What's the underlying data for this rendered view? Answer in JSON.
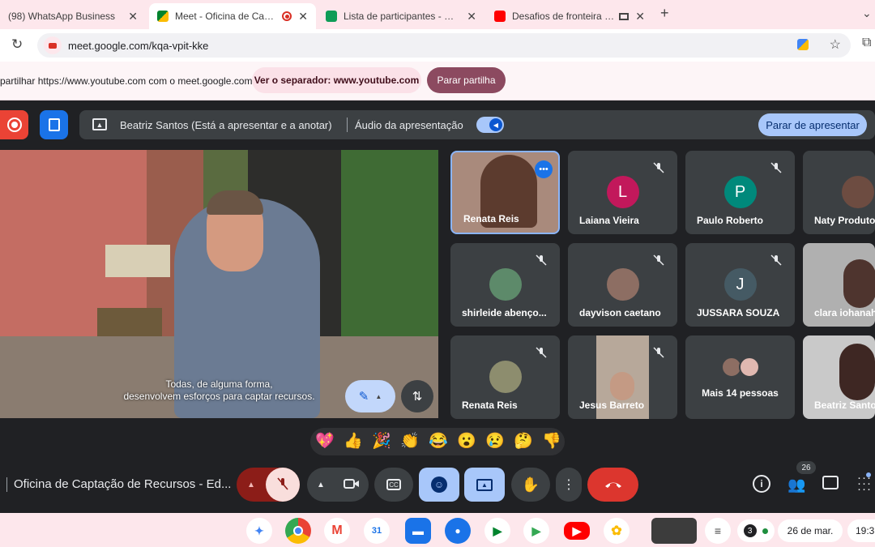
{
  "browser": {
    "tabs": [
      {
        "title": "(98) WhatsApp Business"
      },
      {
        "title": "Meet - Oficina de Captação"
      },
      {
        "title": "Lista de participantes - Oficina"
      },
      {
        "title": "Desafios de fronteira no de"
      }
    ],
    "new_tab": "+",
    "url": "meet.google.com/kqa-vpit-kke"
  },
  "sharebar": {
    "message": "partilhar https://www.youtube.com com o meet.google.com...",
    "view_tab_label": "Ver o separador: www.youtube.com",
    "stop_share_label": "Parar partilha"
  },
  "presenter": {
    "status": "Beatriz Santos (Está a apresentar e a anotar)",
    "audio_label": "Áudio da apresentação",
    "stop_presenting_label": "Parar de apresentar"
  },
  "video": {
    "caption_line1": "Todas, de alguma forma,",
    "caption_line2": "desenvolvem esforços para captar recursos."
  },
  "participants": [
    {
      "name": "Renata Reis",
      "initial": "",
      "color": "#7a5a4a",
      "muted": false,
      "camera": true
    },
    {
      "name": "Laiana Vieira",
      "initial": "L",
      "color": "#c2185b",
      "muted": true,
      "camera": false
    },
    {
      "name": "Paulo Roberto",
      "initial": "P",
      "color": "#00897b",
      "muted": true,
      "camera": false
    },
    {
      "name": "Naty Produto",
      "initial": "",
      "color": "#6d4c41",
      "muted": false,
      "camera": false
    },
    {
      "name": "shirleide abenço...",
      "initial": "",
      "color": "#5d8a6a",
      "muted": true,
      "camera": false
    },
    {
      "name": "dayvison caetano",
      "initial": "",
      "color": "#8d6e63",
      "muted": true,
      "camera": false
    },
    {
      "name": "JUSSARA SOUZA",
      "initial": "J",
      "color": "#455a64",
      "muted": true,
      "camera": false
    },
    {
      "name": "clara iohanah",
      "initial": "",
      "color": "#9e9e9e",
      "muted": false,
      "camera": true
    },
    {
      "name": "Renata Reis",
      "initial": "",
      "color": "#8d8d6e",
      "muted": true,
      "camera": false
    },
    {
      "name": "Jesus Barreto",
      "initial": "",
      "color": "#a1887f",
      "muted": true,
      "camera": true
    },
    {
      "name": "Mais 14 pessoas",
      "initial": "",
      "color": "#3c4043",
      "muted": false,
      "camera": false
    },
    {
      "name": "Beatriz Santos",
      "initial": "",
      "color": "#bdbdbd",
      "muted": false,
      "camera": true
    }
  ],
  "reactions": [
    "💖",
    "👍",
    "🎉",
    "👏",
    "😂",
    "😮",
    "😢",
    "🤔",
    "👎"
  ],
  "meeting": {
    "title": "Oficina de Captação de Recursos - Ed...",
    "participant_count": "26"
  },
  "shelf": {
    "notification_count": "3",
    "date": "26 de mar.",
    "time": "19:3"
  },
  "colors": {
    "accent": "#a8c7fa",
    "end_call": "#dc362e",
    "record": "#ea4335",
    "tab_bg": "#fde7ec"
  }
}
